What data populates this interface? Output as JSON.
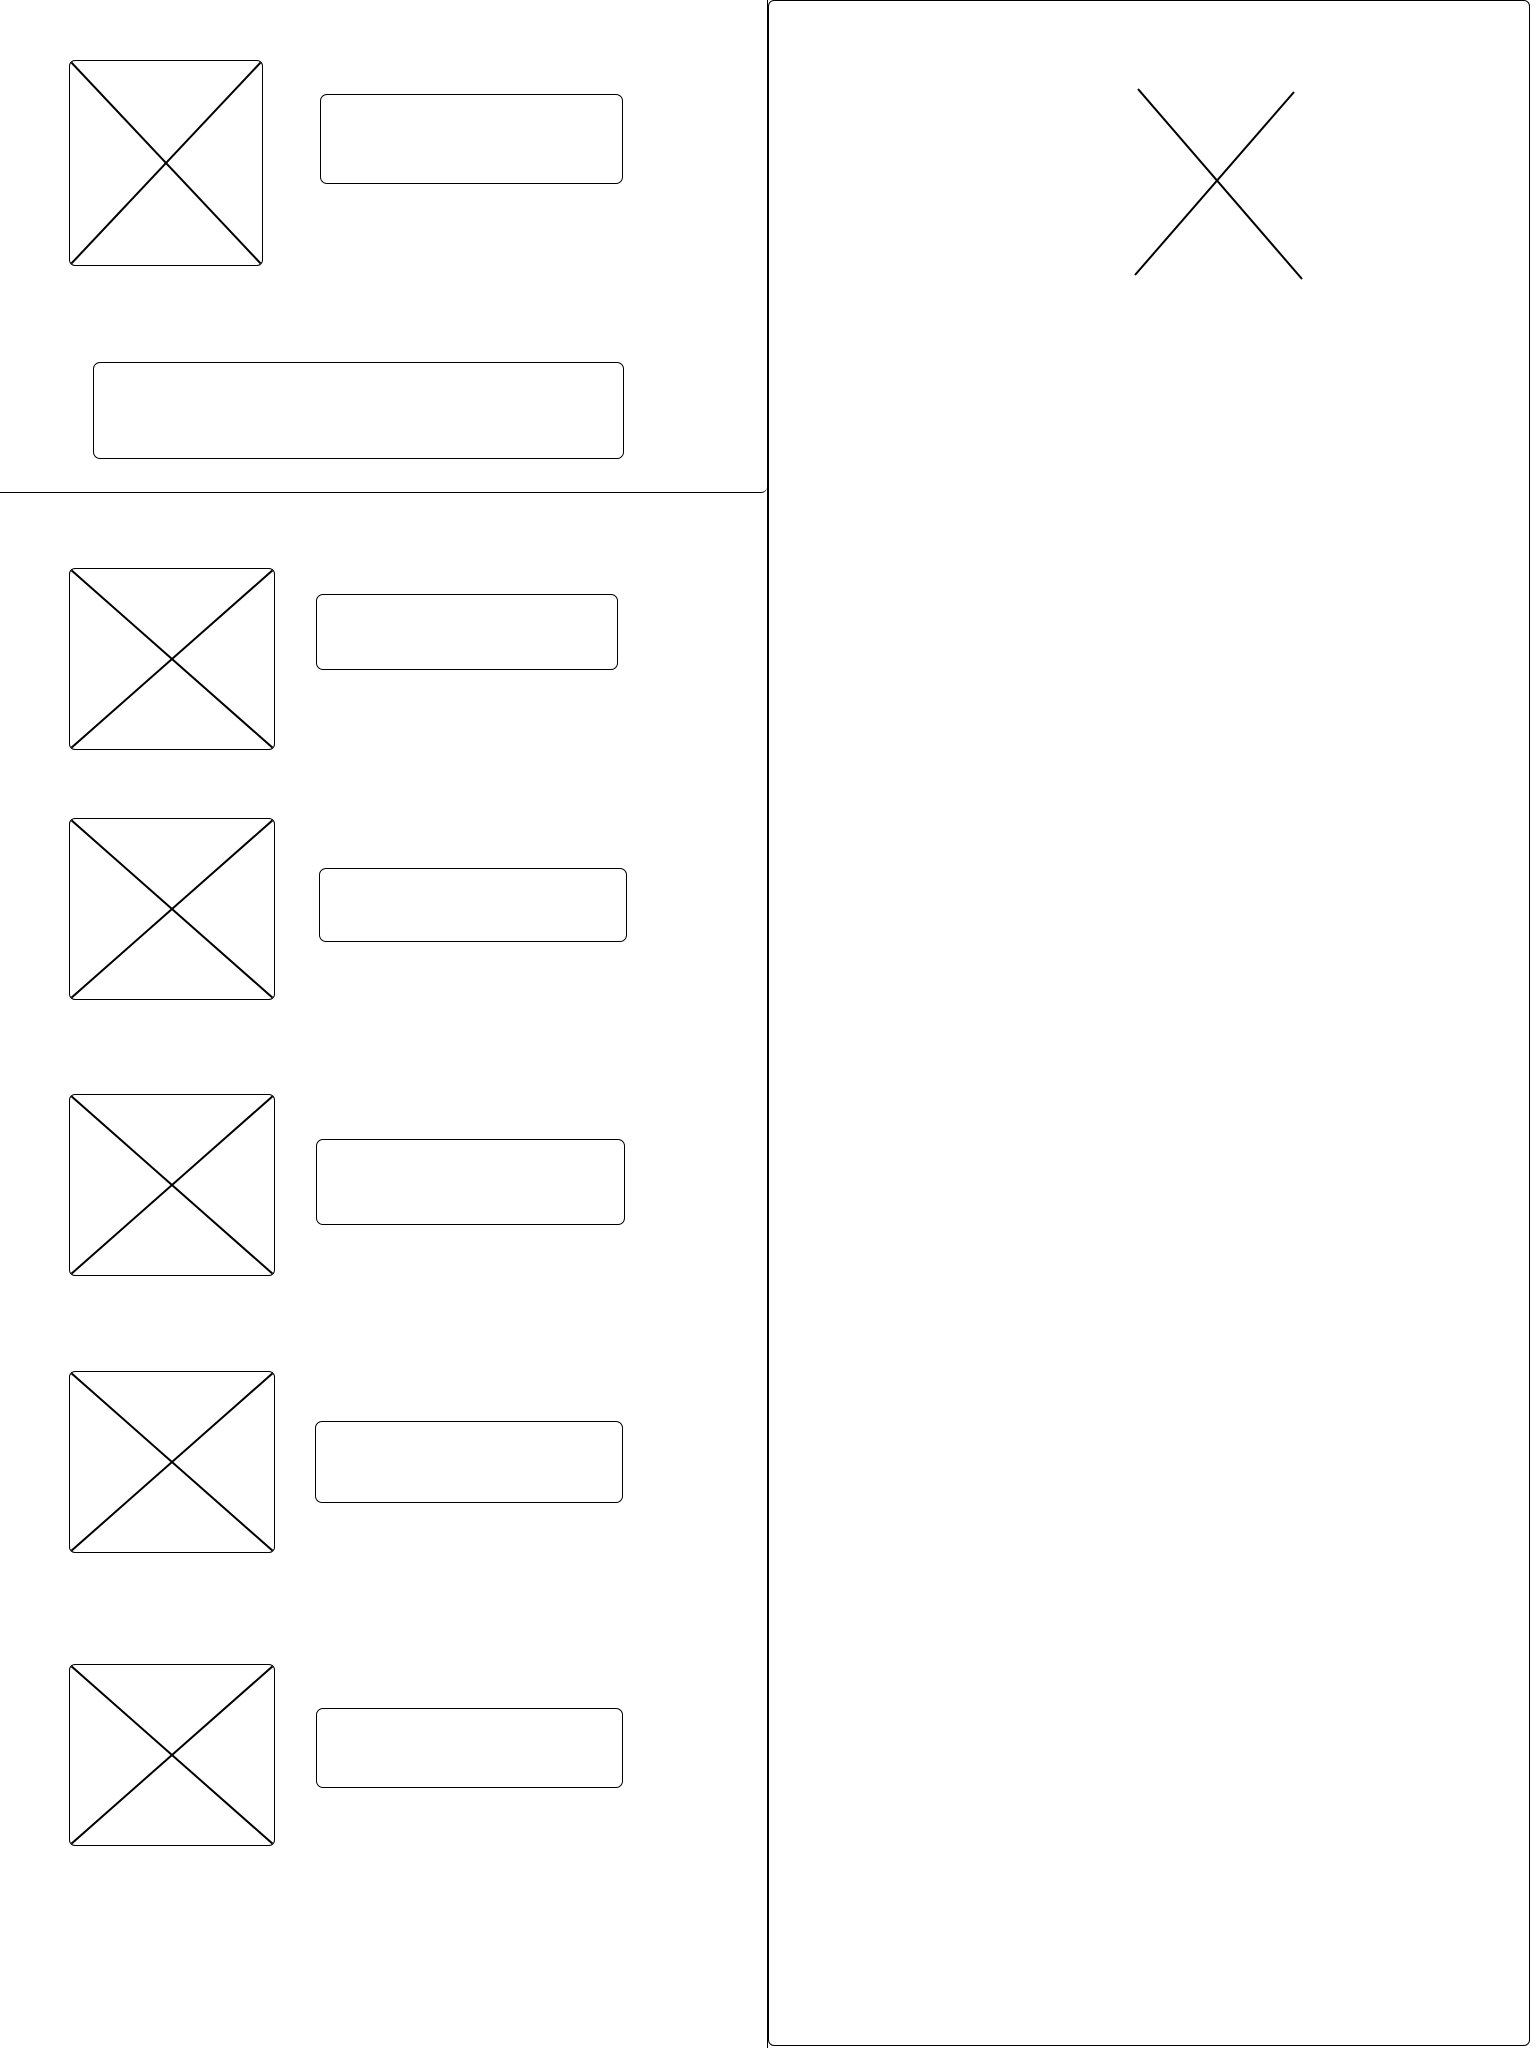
{
  "header": {
    "avatar": "image-placeholder",
    "title": "",
    "subtitle": ""
  },
  "list": {
    "items": [
      {
        "thumb": "image-placeholder",
        "label": ""
      },
      {
        "thumb": "image-placeholder",
        "label": ""
      },
      {
        "thumb": "image-placeholder",
        "label": ""
      },
      {
        "thumb": "image-placeholder",
        "label": ""
      },
      {
        "thumb": "image-placeholder",
        "label": ""
      }
    ]
  },
  "detail": {
    "close_icon": "close-icon"
  }
}
